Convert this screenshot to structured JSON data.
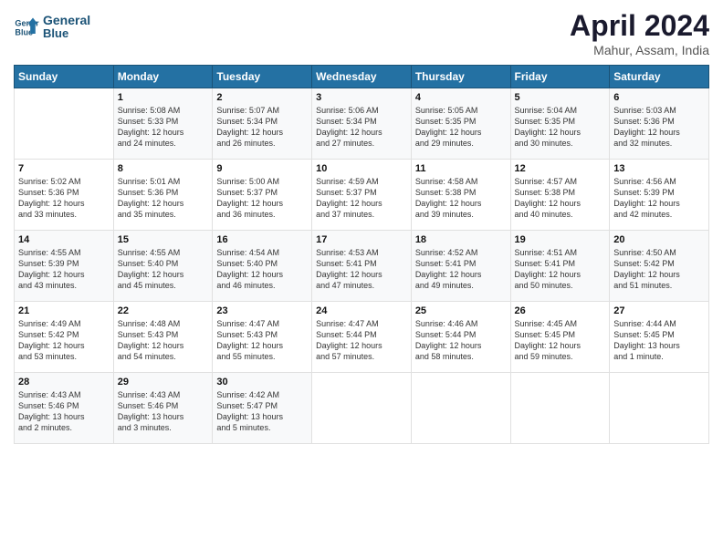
{
  "header": {
    "logo_line1": "General",
    "logo_line2": "Blue",
    "month_year": "April 2024",
    "location": "Mahur, Assam, India"
  },
  "weekdays": [
    "Sunday",
    "Monday",
    "Tuesday",
    "Wednesday",
    "Thursday",
    "Friday",
    "Saturday"
  ],
  "weeks": [
    [
      {
        "day": "",
        "content": ""
      },
      {
        "day": "1",
        "content": "Sunrise: 5:08 AM\nSunset: 5:33 PM\nDaylight: 12 hours\nand 24 minutes."
      },
      {
        "day": "2",
        "content": "Sunrise: 5:07 AM\nSunset: 5:34 PM\nDaylight: 12 hours\nand 26 minutes."
      },
      {
        "day": "3",
        "content": "Sunrise: 5:06 AM\nSunset: 5:34 PM\nDaylight: 12 hours\nand 27 minutes."
      },
      {
        "day": "4",
        "content": "Sunrise: 5:05 AM\nSunset: 5:35 PM\nDaylight: 12 hours\nand 29 minutes."
      },
      {
        "day": "5",
        "content": "Sunrise: 5:04 AM\nSunset: 5:35 PM\nDaylight: 12 hours\nand 30 minutes."
      },
      {
        "day": "6",
        "content": "Sunrise: 5:03 AM\nSunset: 5:36 PM\nDaylight: 12 hours\nand 32 minutes."
      }
    ],
    [
      {
        "day": "7",
        "content": "Sunrise: 5:02 AM\nSunset: 5:36 PM\nDaylight: 12 hours\nand 33 minutes."
      },
      {
        "day": "8",
        "content": "Sunrise: 5:01 AM\nSunset: 5:36 PM\nDaylight: 12 hours\nand 35 minutes."
      },
      {
        "day": "9",
        "content": "Sunrise: 5:00 AM\nSunset: 5:37 PM\nDaylight: 12 hours\nand 36 minutes."
      },
      {
        "day": "10",
        "content": "Sunrise: 4:59 AM\nSunset: 5:37 PM\nDaylight: 12 hours\nand 37 minutes."
      },
      {
        "day": "11",
        "content": "Sunrise: 4:58 AM\nSunset: 5:38 PM\nDaylight: 12 hours\nand 39 minutes."
      },
      {
        "day": "12",
        "content": "Sunrise: 4:57 AM\nSunset: 5:38 PM\nDaylight: 12 hours\nand 40 minutes."
      },
      {
        "day": "13",
        "content": "Sunrise: 4:56 AM\nSunset: 5:39 PM\nDaylight: 12 hours\nand 42 minutes."
      }
    ],
    [
      {
        "day": "14",
        "content": "Sunrise: 4:55 AM\nSunset: 5:39 PM\nDaylight: 12 hours\nand 43 minutes."
      },
      {
        "day": "15",
        "content": "Sunrise: 4:55 AM\nSunset: 5:40 PM\nDaylight: 12 hours\nand 45 minutes."
      },
      {
        "day": "16",
        "content": "Sunrise: 4:54 AM\nSunset: 5:40 PM\nDaylight: 12 hours\nand 46 minutes."
      },
      {
        "day": "17",
        "content": "Sunrise: 4:53 AM\nSunset: 5:41 PM\nDaylight: 12 hours\nand 47 minutes."
      },
      {
        "day": "18",
        "content": "Sunrise: 4:52 AM\nSunset: 5:41 PM\nDaylight: 12 hours\nand 49 minutes."
      },
      {
        "day": "19",
        "content": "Sunrise: 4:51 AM\nSunset: 5:41 PM\nDaylight: 12 hours\nand 50 minutes."
      },
      {
        "day": "20",
        "content": "Sunrise: 4:50 AM\nSunset: 5:42 PM\nDaylight: 12 hours\nand 51 minutes."
      }
    ],
    [
      {
        "day": "21",
        "content": "Sunrise: 4:49 AM\nSunset: 5:42 PM\nDaylight: 12 hours\nand 53 minutes."
      },
      {
        "day": "22",
        "content": "Sunrise: 4:48 AM\nSunset: 5:43 PM\nDaylight: 12 hours\nand 54 minutes."
      },
      {
        "day": "23",
        "content": "Sunrise: 4:47 AM\nSunset: 5:43 PM\nDaylight: 12 hours\nand 55 minutes."
      },
      {
        "day": "24",
        "content": "Sunrise: 4:47 AM\nSunset: 5:44 PM\nDaylight: 12 hours\nand 57 minutes."
      },
      {
        "day": "25",
        "content": "Sunrise: 4:46 AM\nSunset: 5:44 PM\nDaylight: 12 hours\nand 58 minutes."
      },
      {
        "day": "26",
        "content": "Sunrise: 4:45 AM\nSunset: 5:45 PM\nDaylight: 12 hours\nand 59 minutes."
      },
      {
        "day": "27",
        "content": "Sunrise: 4:44 AM\nSunset: 5:45 PM\nDaylight: 13 hours\nand 1 minute."
      }
    ],
    [
      {
        "day": "28",
        "content": "Sunrise: 4:43 AM\nSunset: 5:46 PM\nDaylight: 13 hours\nand 2 minutes."
      },
      {
        "day": "29",
        "content": "Sunrise: 4:43 AM\nSunset: 5:46 PM\nDaylight: 13 hours\nand 3 minutes."
      },
      {
        "day": "30",
        "content": "Sunrise: 4:42 AM\nSunset: 5:47 PM\nDaylight: 13 hours\nand 5 minutes."
      },
      {
        "day": "",
        "content": ""
      },
      {
        "day": "",
        "content": ""
      },
      {
        "day": "",
        "content": ""
      },
      {
        "day": "",
        "content": ""
      }
    ]
  ]
}
